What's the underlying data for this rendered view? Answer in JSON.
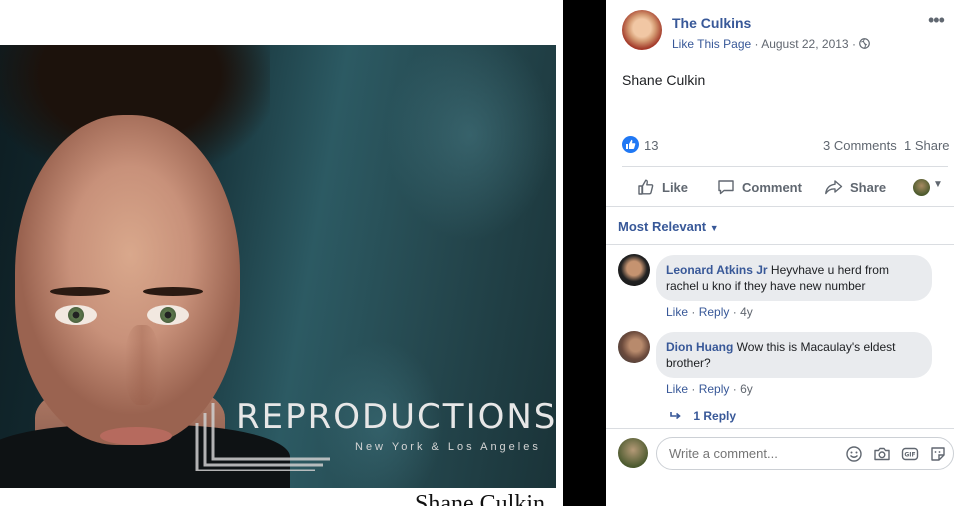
{
  "photo": {
    "logo_word": "REPRODUCTIONS",
    "logo_sub": "New York & Los Angeles",
    "caption_fragment": "Shane Culkin"
  },
  "post": {
    "page_name": "The Culkins",
    "like_page": "Like This Page",
    "separator": "·",
    "date": "August 22, 2013",
    "text": "Shane Culkin",
    "more_icon": "more-options-icon",
    "privacy_icon": "globe-icon"
  },
  "stats": {
    "reactions": "13",
    "comments": "3 Comments",
    "shares": "1 Share"
  },
  "actions": {
    "like": "Like",
    "comment": "Comment",
    "share": "Share"
  },
  "comments_panel": {
    "filter_label": "Most Relevant",
    "comments": [
      {
        "author": "Leonard Atkins Jr",
        "text": "Heyvhave u herd from rachel u kno if they have new number",
        "like": "Like",
        "reply": "Reply",
        "age": "4y"
      },
      {
        "author": "Dion Huang",
        "text": "Wow this is Macaulay's eldest brother?",
        "like": "Like",
        "reply": "Reply",
        "age": "6y"
      }
    ],
    "replies_link": "1 Reply",
    "composer_placeholder": "Write a comment..."
  },
  "colors": {
    "link_blue": "#385898",
    "like_blue": "#2078f4",
    "bubble_gray": "#e9ebee"
  }
}
